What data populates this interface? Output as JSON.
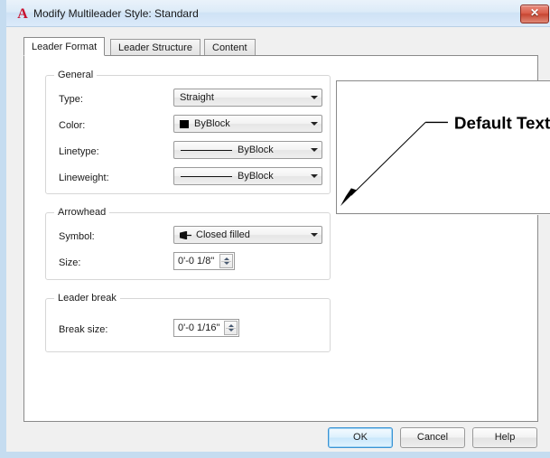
{
  "window": {
    "title": "Modify Multileader Style: Standard",
    "app_icon": "autocad-a-icon",
    "close_label": "✕"
  },
  "tabs": [
    {
      "label": "Leader Format",
      "active": true
    },
    {
      "label": "Leader Structure",
      "active": false
    },
    {
      "label": "Content",
      "active": false
    }
  ],
  "groups": {
    "general": {
      "title": "General",
      "rows": [
        {
          "label": "Type:",
          "value": "Straight",
          "control": "combobox"
        },
        {
          "label": "Color:",
          "value": "ByBlock",
          "control": "combobox",
          "icon": "black-color-swatch"
        },
        {
          "label": "Linetype:",
          "value": "ByBlock",
          "control": "combobox",
          "icon": "continuous-line-sample"
        },
        {
          "label": "Lineweight:",
          "value": "ByBlock",
          "control": "combobox",
          "icon": "lineweight-line-sample"
        }
      ]
    },
    "arrowhead": {
      "title": "Arrowhead",
      "rows": [
        {
          "label": "Symbol:",
          "value": "Closed filled",
          "control": "combobox",
          "icon": "closed-filled-arrow"
        },
        {
          "label": "Size:",
          "value": "0'-0 1/8\"",
          "control": "spinner"
        }
      ]
    },
    "leader_break": {
      "title": "Leader break",
      "rows": [
        {
          "label": "Break size:",
          "value": "0'-0 1/16\"",
          "control": "spinner"
        }
      ]
    }
  },
  "preview": {
    "text": "Default Text",
    "description": "multileader-preview"
  },
  "buttons": [
    {
      "label": "OK",
      "default": true
    },
    {
      "label": "Cancel",
      "default": false
    },
    {
      "label": "Help",
      "default": false
    }
  ],
  "colors": {
    "titlebar": "#cfe2f5",
    "frame": "#c5dcf0",
    "dialog_bg": "#f0f0f0",
    "panel_bg": "#ffffff",
    "close_red": "#c74632",
    "accent_blue": "#3b93d4",
    "logo_red": "#c8102e"
  }
}
